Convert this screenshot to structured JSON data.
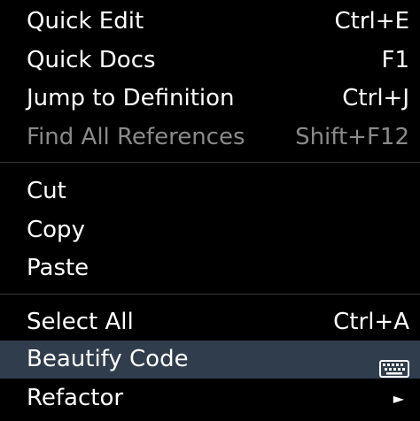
{
  "menu": {
    "groups": [
      {
        "items": [
          {
            "label": "Quick Edit",
            "shortcut": "Ctrl+E",
            "disabled": false
          },
          {
            "label": "Quick Docs",
            "shortcut": "F1",
            "disabled": false
          },
          {
            "label": "Jump to Definition",
            "shortcut": "Ctrl+J",
            "disabled": false
          },
          {
            "label": "Find All References",
            "shortcut": "Shift+F12",
            "disabled": true
          }
        ]
      },
      {
        "items": [
          {
            "label": "Cut",
            "shortcut": ""
          },
          {
            "label": "Copy",
            "shortcut": ""
          },
          {
            "label": "Paste",
            "shortcut": ""
          }
        ]
      },
      {
        "items": [
          {
            "label": "Select All",
            "shortcut": "Ctrl+A"
          },
          {
            "label": "Beautify Code",
            "icon": "keyboard-icon",
            "highlighted": true
          },
          {
            "label": "Refactor",
            "icon": "submenu-arrow-icon"
          }
        ]
      }
    ]
  },
  "colors": {
    "background": "#000000",
    "text": "#ffffff",
    "disabled_text": "#8a8a8a",
    "highlight": "#2f3d4c",
    "divider": "#3a3a3a"
  }
}
